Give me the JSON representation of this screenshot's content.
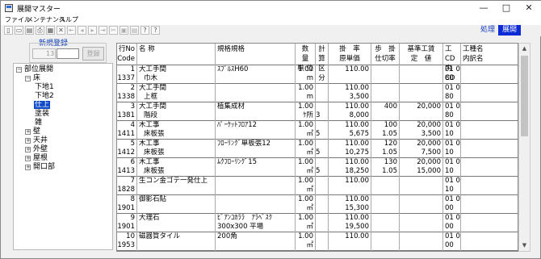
{
  "window": {
    "title": "展開マスター",
    "controls": {
      "minimize": "—",
      "maximize": "□",
      "close": "✕"
    }
  },
  "menubar": {
    "items": [
      "ファイル",
      "メンテナンス",
      "ヘルプ"
    ]
  },
  "toolbar": {
    "icons": [
      "new-file-icon",
      "open-icon",
      "save-icon",
      "print-icon",
      "preview-icon",
      "delete-icon",
      "first-record-icon",
      "prev-record-icon",
      "next-record-icon",
      "last-record-icon",
      "cut-icon",
      "copy-icon",
      "paste-icon",
      "context-help-icon",
      "help-icon"
    ],
    "glyphs": [
      "▯",
      "▭",
      "▤",
      "⎙",
      "▦",
      "✕",
      "⇤",
      "◂",
      "▸",
      "⇥",
      "✂",
      "▣",
      "▤",
      "?",
      "?"
    ]
  },
  "mode": {
    "process": "処理",
    "expand": "展開"
  },
  "new_registration": {
    "title": "新規登録",
    "code_prefix": "13",
    "code_value": "",
    "register_button": "登録"
  },
  "tree": [
    {
      "label": "部位展開",
      "level": 0,
      "toggle": "⊟"
    },
    {
      "label": "床",
      "level": 1,
      "toggle": "⊟"
    },
    {
      "label": "下地1",
      "level": 2,
      "toggle": ""
    },
    {
      "label": "下地2",
      "level": 2,
      "toggle": ""
    },
    {
      "label": "仕上",
      "level": 2,
      "toggle": "",
      "selected": true
    },
    {
      "label": "塗装",
      "level": 2,
      "toggle": ""
    },
    {
      "label": "雑",
      "level": 2,
      "toggle": ""
    },
    {
      "label": "壁",
      "level": 1,
      "toggle": "⊞"
    },
    {
      "label": "天井",
      "level": 1,
      "toggle": "⊞"
    },
    {
      "label": "外壁",
      "level": 1,
      "toggle": "⊞"
    },
    {
      "label": "屋根",
      "level": 1,
      "toggle": "⊞"
    },
    {
      "label": "開口部",
      "level": 1,
      "toggle": "⊞"
    }
  ],
  "grid": {
    "headers": {
      "rowno": [
        "行No",
        "Code"
      ],
      "name": [
        "",
        "名  称"
      ],
      "spec": [
        "",
        "規格規格"
      ],
      "qty": [
        "数　量",
        "単 位"
      ],
      "calc": [
        "計算",
        "区分"
      ],
      "rate": [
        "掛　率",
        "原単価"
      ],
      "yield": [
        "歩　掛",
        "仕切率"
      ],
      "base": [
        "基準工賃",
        "定　値"
      ],
      "cd": [
        "工CD",
        "内CD"
      ],
      "work": [
        "工種名",
        "内訳名"
      ]
    },
    "rows": [
      {
        "no": "1",
        "code": "1337",
        "name1": "大工手間",
        "name2": "巾木",
        "spec1": "ｽﾌﾟﾙｽH60",
        "spec2": "",
        "qty": "1.00",
        "unit": "m",
        "calc": "",
        "rate1": "110.00",
        "rate2": "",
        "yield1": "",
        "yield2": "",
        "base1": "",
        "base2": "",
        "cd1": "01 03",
        "cd2": "80"
      },
      {
        "no": "2",
        "code": "1338",
        "name1": "大工手間",
        "name2": "上框",
        "spec1": "",
        "spec2": "",
        "qty": "1.00",
        "unit": "m",
        "calc": "",
        "rate1": "110.00",
        "rate2": "3,500",
        "yield1": "",
        "yield2": "",
        "base1": "",
        "base2": "",
        "cd1": "01 03",
        "cd2": "80"
      },
      {
        "no": "3",
        "code": "1381",
        "name1": "大工手間",
        "name2": "階段",
        "spec1": "植集成材",
        "spec2": "",
        "qty": "1.00",
        "unit": "ｹ所",
        "calc": "3",
        "rate1": "110.00",
        "rate2": "8,000",
        "yield1": "400",
        "yield2": "",
        "base1": "20,000",
        "base2": "",
        "cd1": "01 03",
        "cd2": "80"
      },
      {
        "no": "4",
        "code": "1411",
        "name1": "木工事",
        "name2": "床板張",
        "spec1": "ﾊﾟｰｹｯﾄﾌﾛｱ12",
        "spec2": "",
        "qty": "1.00",
        "unit": "㎡",
        "calc": "5",
        "rate1": "110.00",
        "rate2": "5,675",
        "yield1": "100",
        "yield2": "1.05",
        "base1": "20,000",
        "base2": "3,500",
        "cd1": "01 03",
        "cd2": "10"
      },
      {
        "no": "5",
        "code": "1412",
        "name1": "木工事",
        "name2": "床板張",
        "spec1": "ﾌﾛｰﾘﾝｸﾞ単板張12",
        "spec2": "",
        "qty": "1.00",
        "unit": "㎡",
        "calc": "5",
        "rate1": "110.00",
        "rate2": "10,275",
        "yield1": "120",
        "yield2": "1.05",
        "base1": "20,000",
        "base2": "7,500",
        "cd1": "01 03",
        "cd2": "10"
      },
      {
        "no": "6",
        "code": "1413",
        "name1": "木工事",
        "name2": "床板張",
        "spec1": "ﾑｸﾌﾛｰﾘﾝｸﾞ15",
        "spec2": "",
        "qty": "1.00",
        "unit": "㎡",
        "calc": "5",
        "rate1": "110.00",
        "rate2": "18,250",
        "yield1": "130",
        "yield2": "1.05",
        "base1": "20,000",
        "base2": "15,000",
        "cd1": "01 03",
        "cd2": "10"
      },
      {
        "no": "7",
        "code": "1828",
        "name1": "生コン金ゴテ一発仕上",
        "name2": "",
        "spec1": "",
        "spec2": "",
        "qty": "1.00",
        "unit": "㎡",
        "calc": "",
        "rate1": "110.00",
        "rate2": "",
        "yield1": "",
        "yield2": "",
        "base1": "",
        "base2": "",
        "cd1": "01 08",
        "cd2": "10"
      },
      {
        "no": "8",
        "code": "1901",
        "name1": "御影石貼",
        "name2": "",
        "spec1": "",
        "spec2": "",
        "qty": "1.00",
        "unit": "㎡",
        "calc": "",
        "rate1": "110.00",
        "rate2": "15,300",
        "yield1": "",
        "yield2": "",
        "base1": "",
        "base2": "",
        "cd1": "01 09",
        "cd2": "00"
      },
      {
        "no": "9",
        "code": "1901",
        "name1": "大理石",
        "name2": "",
        "spec1": "ﾋﾞｱﾝｺｶﾗﾗ　ｱﾗﾍﾞｽｸ",
        "spec2": "300x300 平場",
        "qty": "1.00",
        "unit": "㎡",
        "calc": "",
        "rate1": "110.00",
        "rate2": "19,500",
        "yield1": "",
        "yield2": "",
        "base1": "",
        "base2": "",
        "cd1": "01 09",
        "cd2": "00"
      },
      {
        "no": "10",
        "code": "1953",
        "name1": "磁器質タイル",
        "name2": "",
        "spec1": "200角",
        "spec2": "",
        "qty": "1.00",
        "unit": "㎡",
        "calc": "",
        "rate1": "110.00",
        "rate2": "",
        "yield1": "",
        "yield2": "",
        "base1": "",
        "base2": "",
        "cd1": "01 09",
        "cd2": "00"
      }
    ]
  },
  "scrollbar": {
    "up": "▲",
    "down": "▼"
  }
}
